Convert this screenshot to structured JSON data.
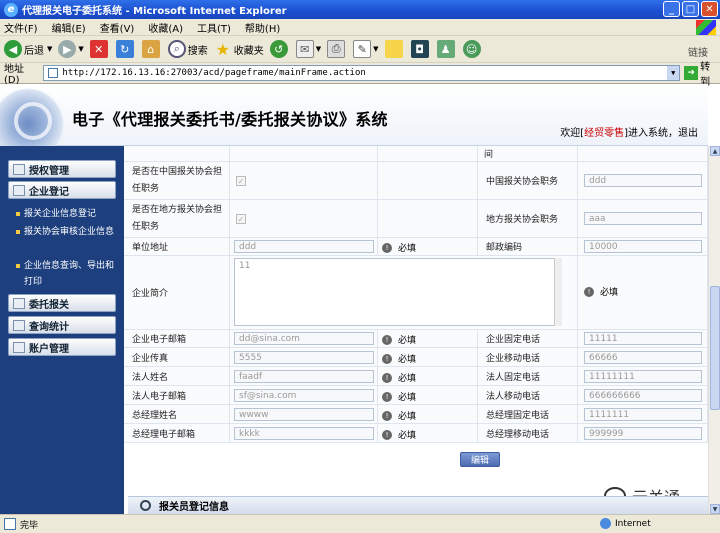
{
  "window": {
    "title": "代理报关电子委托系统 - Microsoft Internet Explorer",
    "controls": {
      "minimize": "_",
      "maximize": "□",
      "close": "✕"
    }
  },
  "menu": [
    "文件(F)",
    "编辑(E)",
    "查看(V)",
    "收藏(A)",
    "工具(T)",
    "帮助(H)"
  ],
  "toolbar": {
    "back": "后退",
    "search": "搜索",
    "favorites": "收藏夹",
    "links": "链接"
  },
  "address": {
    "label": "地址(D)",
    "url": "http://172.16.13.16:27003/acd/pageframe/mainFrame.action",
    "go": "转到"
  },
  "header": {
    "title": "电子《代理报关委托书/委托报关协议》系统",
    "welcome_prefix": "欢迎[",
    "username": "经贸零售",
    "welcome_suffix": "]进入系统，退出"
  },
  "sidebar": {
    "sections": [
      {
        "label": "授权管理"
      },
      {
        "label": "企业登记"
      },
      {
        "label": "委托报关"
      },
      {
        "label": "查询统计"
      },
      {
        "label": "账户管理"
      }
    ],
    "sub_items": [
      "报关企业信息登记",
      "报关协会审核企业信息",
      "企业信息查询、导出和打印"
    ]
  },
  "form": {
    "partial_label": "间",
    "rows": {
      "cn_assoc": {
        "label": "是否在中国报关协会担任职务",
        "right_label": "中国报关协会职务",
        "right_value": "ddd"
      },
      "local_assoc": {
        "label": "是否在地方报关协会担任职务",
        "right_label": "地方报关协会职务",
        "right_value": "aaa"
      },
      "address": {
        "label": "单位地址",
        "value": "ddd",
        "required": "必填",
        "right_label": "邮政编码",
        "right_value": "10000"
      },
      "intro": {
        "label": "企业简介",
        "value": "11",
        "required": "必填"
      },
      "email": {
        "label": "企业电子邮箱",
        "value": "dd@sina.com",
        "required": "必填",
        "right_label": "企业固定电话",
        "right_value": "11111"
      },
      "fax": {
        "label": "企业传真",
        "value": "5555",
        "required": "必填",
        "right_label": "企业移动电话",
        "right_value": "66666"
      },
      "legal_name": {
        "label": "法人姓名",
        "value": "faadf",
        "required": "必填",
        "right_label": "法人固定电话",
        "right_value": "11111111"
      },
      "legal_email": {
        "label": "法人电子邮箱",
        "value": "sf@sina.com",
        "required": "必填",
        "right_label": "法人移动电话",
        "right_value": "666666666"
      },
      "gm_name": {
        "label": "总经理姓名",
        "value": "wwww",
        "required": "必填",
        "right_label": "总经理固定电话",
        "right_value": "1111111"
      },
      "gm_email": {
        "label": "总经理电子邮箱",
        "value": "kkkk",
        "required": "必填",
        "right_label": "总经理移动电话",
        "right_value": "999999"
      }
    },
    "edit_button": "编辑",
    "next_section": "报关员登记信息"
  },
  "watermark": "云关通",
  "status": {
    "left": "完毕",
    "zone": "Internet"
  }
}
